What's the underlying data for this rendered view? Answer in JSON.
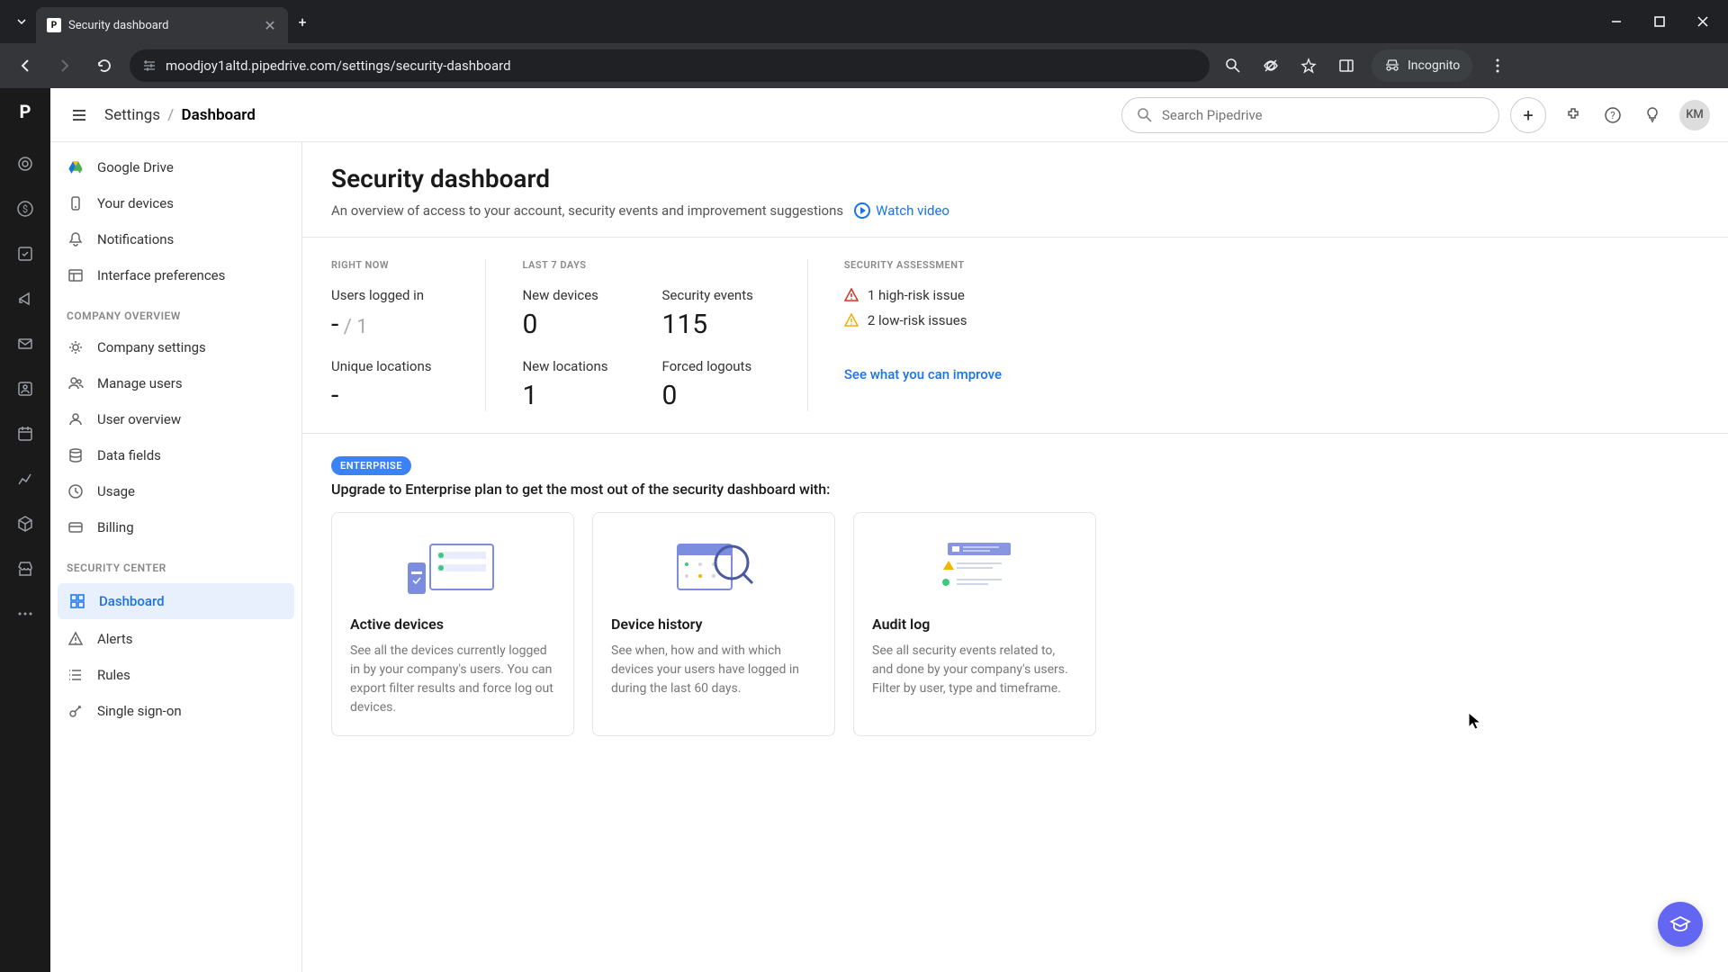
{
  "browser": {
    "tab_title": "Security dashboard",
    "url": "moodjoy1altd.pipedrive.com/settings/security-dashboard",
    "incognito_label": "Incognito"
  },
  "topbar": {
    "breadcrumb_root": "Settings",
    "breadcrumb_current": "Dashboard",
    "search_placeholder": "Search Pipedrive",
    "avatar_initials": "KM"
  },
  "sidebar": {
    "items_personal": [
      {
        "label": "Google Drive",
        "icon": "gdrive"
      },
      {
        "label": "Your devices",
        "icon": "phone"
      },
      {
        "label": "Notifications",
        "icon": "bell"
      },
      {
        "label": "Interface preferences",
        "icon": "layout"
      }
    ],
    "header_company": "COMPANY OVERVIEW",
    "items_company": [
      {
        "label": "Company settings",
        "icon": "gear"
      },
      {
        "label": "Manage users",
        "icon": "users"
      },
      {
        "label": "User overview",
        "icon": "eye"
      },
      {
        "label": "Data fields",
        "icon": "database"
      },
      {
        "label": "Usage",
        "icon": "chart"
      },
      {
        "label": "Billing",
        "icon": "card"
      }
    ],
    "header_security": "SECURITY CENTER",
    "items_security": [
      {
        "label": "Dashboard",
        "icon": "grid",
        "active": true
      },
      {
        "label": "Alerts",
        "icon": "alert"
      },
      {
        "label": "Rules",
        "icon": "list"
      },
      {
        "label": "Single sign-on",
        "icon": "key"
      }
    ]
  },
  "page": {
    "title": "Security dashboard",
    "subtitle": "An overview of access to your account, security events and improvement suggestions",
    "watch_video": "Watch video"
  },
  "stats": {
    "col1_head": "RIGHT NOW",
    "users_logged_label": "Users logged in",
    "users_logged_value": "-",
    "users_logged_total": " / 1",
    "unique_loc_label": "Unique locations",
    "unique_loc_value": "-",
    "col2_head": "LAST 7 DAYS",
    "new_devices_label": "New devices",
    "new_devices_value": "0",
    "sec_events_label": "Security events",
    "sec_events_value": "115",
    "new_loc_label": "New locations",
    "new_loc_value": "1",
    "forced_logout_label": "Forced logouts",
    "forced_logout_value": "0",
    "col3_head": "SECURITY ASSESSMENT",
    "high_risk": "1 high-risk issue",
    "low_risk": "2 low-risk issues",
    "improve_link": "See what you can improve"
  },
  "upgrade": {
    "badge": "ENTERPRISE",
    "text": "Upgrade to Enterprise plan to get the most out of the security dashboard with:",
    "cards": [
      {
        "title": "Active devices",
        "desc": "See all the devices currently logged in by your company's users. You can export filter results and force log out devices."
      },
      {
        "title": "Device history",
        "desc": "See when, how and with which devices your users have logged in during the last 60 days."
      },
      {
        "title": "Audit log",
        "desc": "See all security events related to, and done by your company's users. Filter by user, type and timeframe."
      }
    ]
  }
}
